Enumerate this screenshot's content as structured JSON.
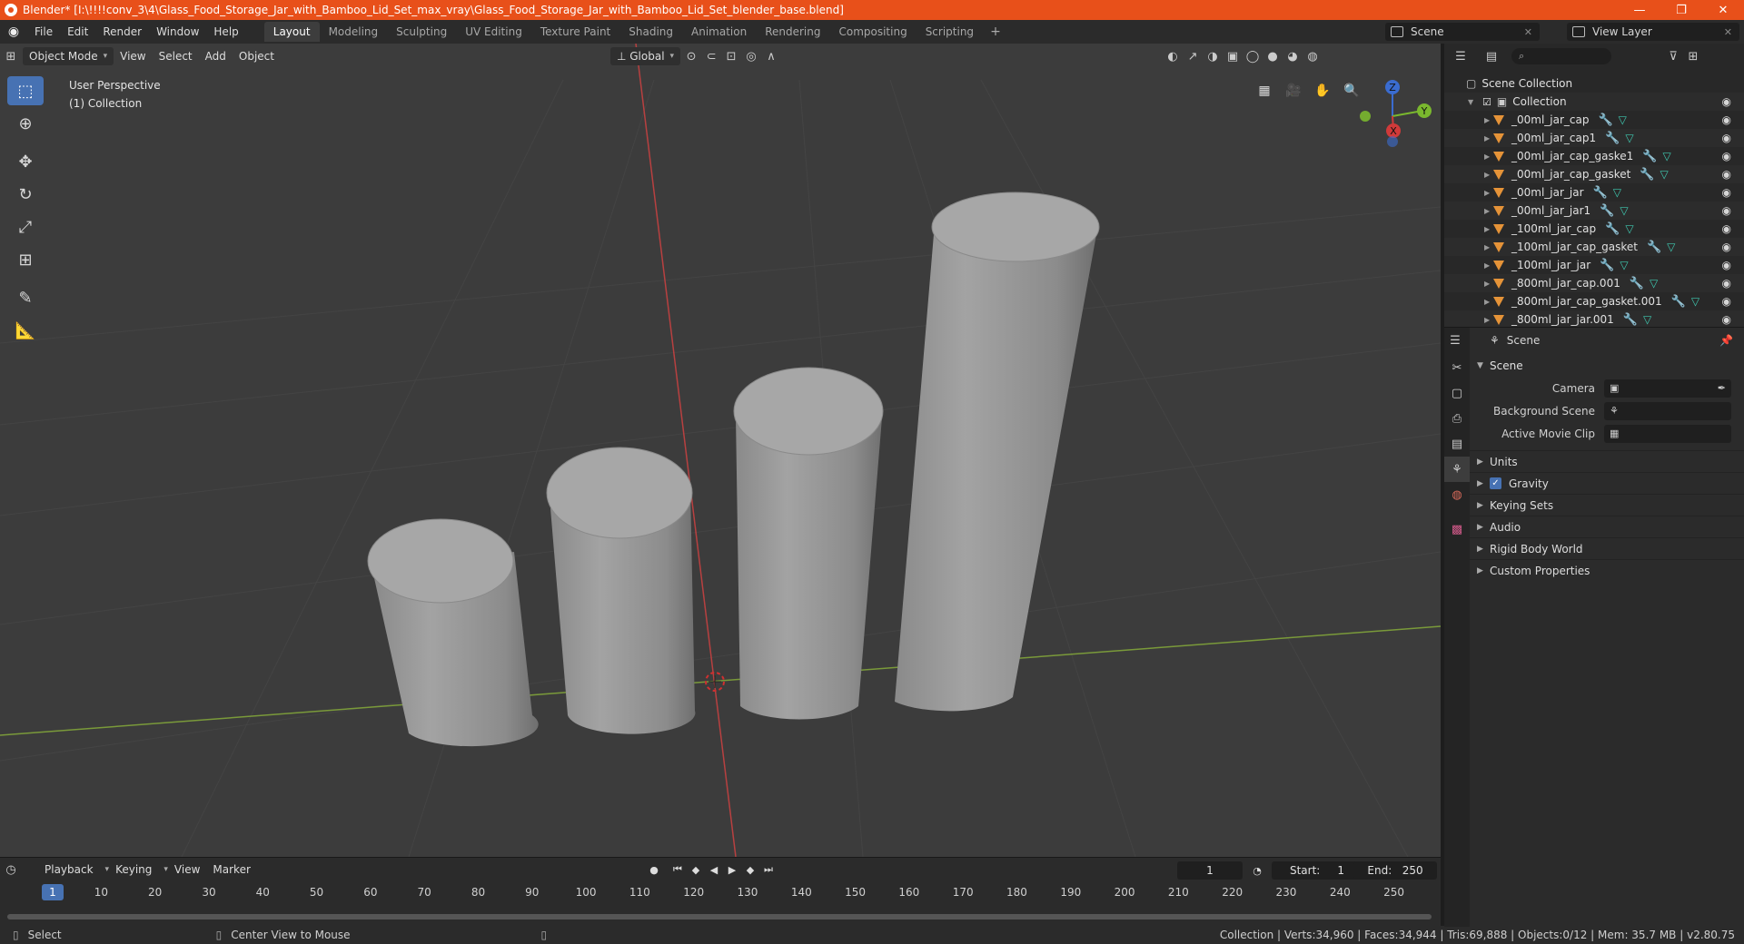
{
  "window": {
    "title": "Blender* [I:\\!!!!conv_3\\4\\Glass_Food_Storage_Jar_with_Bamboo_Lid_Set_max_vray\\Glass_Food_Storage_Jar_with_Bamboo_Lid_Set_blender_base.blend]",
    "minimize": "—",
    "maximize": "❐",
    "close": "✕"
  },
  "menu": [
    "File",
    "Edit",
    "Render",
    "Window",
    "Help"
  ],
  "workspaces": [
    "Layout",
    "Modeling",
    "Sculpting",
    "UV Editing",
    "Texture Paint",
    "Shading",
    "Animation",
    "Rendering",
    "Compositing",
    "Scripting"
  ],
  "active_workspace": "Layout",
  "scene_selector": "Scene",
  "view_layer": "View Layer",
  "viewport": {
    "mode": "Object Mode",
    "menus": [
      "View",
      "Select",
      "Add",
      "Object"
    ],
    "transform_orientation": "Global",
    "perspective_label": "User Perspective",
    "collection_label": "(1) Collection",
    "gizmo": {
      "z": "Z",
      "y": "Y",
      "x": "X"
    }
  },
  "outliner": {
    "root": "Scene Collection",
    "collection": "Collection",
    "items": [
      "_00ml_jar_cap",
      "_00ml_jar_cap1",
      "_00ml_jar_cap_gaske1",
      "_00ml_jar_cap_gasket",
      "_00ml_jar_jar",
      "_00ml_jar_jar1",
      "_100ml_jar_cap",
      "_100ml_jar_cap_gasket",
      "_100ml_jar_jar",
      "_800ml_jar_cap.001",
      "_800ml_jar_cap_gasket.001",
      "_800ml_jar_jar.001"
    ]
  },
  "properties": {
    "context": "Scene",
    "panel": "Scene",
    "camera_label": "Camera",
    "background_scene_label": "Background Scene",
    "active_movie_clip_label": "Active Movie Clip",
    "subpanels": [
      "Units",
      "Gravity",
      "Keying Sets",
      "Audio",
      "Rigid Body World",
      "Custom Properties"
    ]
  },
  "timeline": {
    "menus": [
      "Playback",
      "Keying",
      "View",
      "Marker"
    ],
    "current_frame": "1",
    "start_label": "Start:",
    "start": "1",
    "end_label": "End:",
    "end": "250",
    "ruler": [
      "1",
      "10",
      "20",
      "30",
      "40",
      "50",
      "60",
      "70",
      "80",
      "90",
      "100",
      "110",
      "120",
      "130",
      "140",
      "150",
      "160",
      "170",
      "180",
      "190",
      "200",
      "210",
      "220",
      "230",
      "240",
      "250"
    ]
  },
  "statusbar": {
    "left_action": "Select",
    "middle_action": "Center View to Mouse",
    "stats": "Collection | Verts:34,960 | Faces:34,944 | Tris:69,888 | Objects:0/12 | Mem: 35.7 MB | v2.80.75"
  },
  "colors": {
    "title_bar": "#e8501a",
    "accent": "#4772b3",
    "object_icon": "#e59338"
  }
}
